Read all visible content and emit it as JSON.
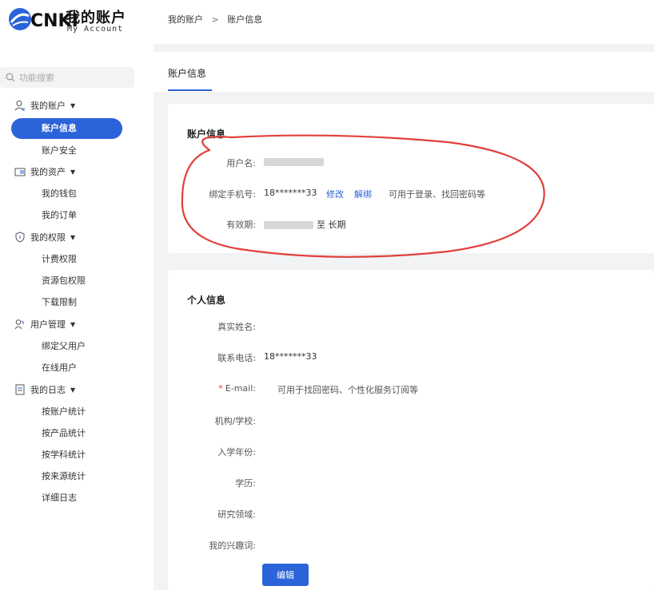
{
  "header": {
    "logo_mark": "CNKI",
    "logo_title": "我的账户",
    "logo_subtitle": "My Account",
    "breadcrumb": [
      "我的账户",
      "账户信息"
    ],
    "breadcrumb_sep": ">"
  },
  "sidebar": {
    "search_placeholder": "功能搜索",
    "groups": [
      {
        "label": "我的账户",
        "icon": "user-icon",
        "items": [
          "账户信息",
          "账户安全"
        ]
      },
      {
        "label": "我的资产",
        "icon": "wallet-icon",
        "items": [
          "我的钱包",
          "我的订单"
        ]
      },
      {
        "label": "我的权限",
        "icon": "shield-icon",
        "items": [
          "计费权限",
          "资源包权限",
          "下载限制"
        ]
      },
      {
        "label": "用户管理",
        "icon": "users-icon",
        "items": [
          "绑定父用户",
          "在线用户"
        ]
      },
      {
        "label": "我的日志",
        "icon": "log-icon",
        "items": [
          "按账户统计",
          "按产品统计",
          "按学科统计",
          "按来源统计",
          "详细日志"
        ]
      }
    ],
    "active_item": "账户信息"
  },
  "main": {
    "tab": "账户信息",
    "account_card": {
      "title": "账户信息",
      "username_label": "用户名:",
      "phone_label": "绑定手机号:",
      "phone_value": "18*******33",
      "phone_modify": "修改",
      "phone_unbind": "解绑",
      "phone_hint": "可用于登录、找回密码等",
      "validity_label": "有效期:",
      "validity_suffix": "至 长期"
    },
    "personal_card": {
      "title": "个人信息",
      "fields": [
        {
          "label": "真实姓名:",
          "value": ""
        },
        {
          "label": "联系电话:",
          "value": "18*******33"
        },
        {
          "label": "E-mail:",
          "value": "可用于找回密码、个性化服务订阅等",
          "required_mark": "*"
        },
        {
          "label": "机构/学校:",
          "value": ""
        },
        {
          "label": "入学年份:",
          "value": ""
        },
        {
          "label": "学历:",
          "value": ""
        },
        {
          "label": "研究领域:",
          "value": ""
        },
        {
          "label": "我的兴趣词:",
          "value": ""
        }
      ],
      "edit_button": "编辑"
    }
  },
  "colors": {
    "accent": "#2b63d9",
    "annotation": "#e0403a",
    "page_bg": "#f2f3f5"
  }
}
